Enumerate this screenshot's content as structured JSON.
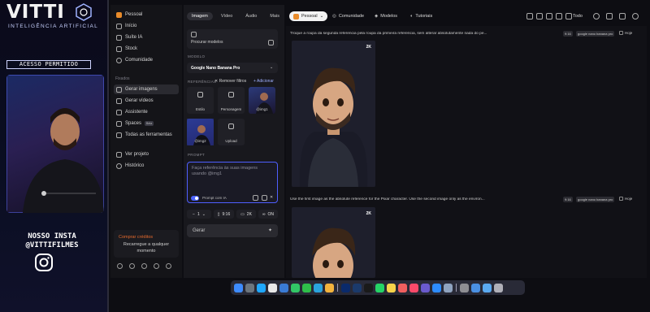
{
  "overlay": {
    "brand_name": "VITTI",
    "brand_sub": "INTELIGÊNCIA ARTIFICIAL",
    "access_label": "ACESSO PERMITIDO",
    "insta_line1": "NOSSO INSTA",
    "insta_line2": "@VITTIFILMES"
  },
  "sidebar": {
    "workspace": "Pessoal",
    "items": [
      {
        "label": "Início"
      },
      {
        "label": "Suíte IA"
      },
      {
        "label": "Stock"
      },
      {
        "label": "Comunidade"
      }
    ],
    "pinned_caption": "Fixados",
    "pinned": [
      {
        "label": "Gerar imagens",
        "active": true
      },
      {
        "label": "Gerar vídeos"
      },
      {
        "label": "Assistente"
      },
      {
        "label": "Spaces",
        "badge": "Beta"
      },
      {
        "label": "Todas as ferramentas"
      }
    ],
    "bottom_links": [
      {
        "label": "Ver projeto"
      },
      {
        "label": "Histórico"
      }
    ],
    "credits_title": "Comprar créditos",
    "credits_sub": "Recarregue a qualquer momento"
  },
  "panel": {
    "tabs": [
      "Imagem",
      "Vídeo",
      "Áudio",
      "Mais"
    ],
    "search_models": "Procurar modelos",
    "model_label": "MODELO",
    "model_value": "Google Nano Banana Pro",
    "references_label": "REFERÊNCIAS",
    "remove_filters": "Remover filtros",
    "add_label": "Adicionar",
    "refs": [
      {
        "label": "Estilo"
      },
      {
        "label": "Personagem"
      },
      {
        "label": "@img1"
      },
      {
        "label": "@img2"
      },
      {
        "label": "Upload"
      }
    ],
    "prompt_label": "PROMPT",
    "prompt_placeholder": "Faça referência às suas imagens usando @img1",
    "improve_label": "Prompt com IA",
    "count": "1",
    "ratio": "9:16",
    "resolution": "2K",
    "on_label": "ON",
    "generate": "Gerar"
  },
  "topbar": {
    "workspace": "Pessoal",
    "links": [
      "Comunidade",
      "Modelos",
      "Tutoriais"
    ],
    "filter": "Todo"
  },
  "feed": [
    {
      "prompt": "Troque a roupa da segunda referencia pela roupa da primeira referencia, sem alterar absolutamente nada do pe...",
      "ratio": "9:16",
      "model": "google nano banana pro",
      "today": "Hoje",
      "resolution": "2K"
    },
    {
      "prompt": "Use the first image as the absolute reference for the Pixar character. Use the second image only as the environ...",
      "ratio": "9:16",
      "model": "google nano banana pro",
      "today": "Hoje",
      "resolution": "2K"
    }
  ],
  "dock_icons": [
    "finder-icon",
    "launchpad-icon",
    "safari-icon",
    "chrome-icon",
    "mail-icon",
    "messages-icon",
    "facetime-icon",
    "telegram-icon",
    "photos-icon",
    "photoshop-icon",
    "lightroom-icon",
    "capcut-icon",
    "whatsapp-icon",
    "notes-icon",
    "calendar-icon",
    "music-icon",
    "finalcut-icon",
    "appstore-icon",
    "preview-icon",
    "settings-icon",
    "folder-icon",
    "downloads-icon",
    "trash-icon"
  ],
  "colors": {
    "accent": "#4c63ff",
    "workspace": "#e98b2a",
    "credits": "#e56a2d"
  }
}
